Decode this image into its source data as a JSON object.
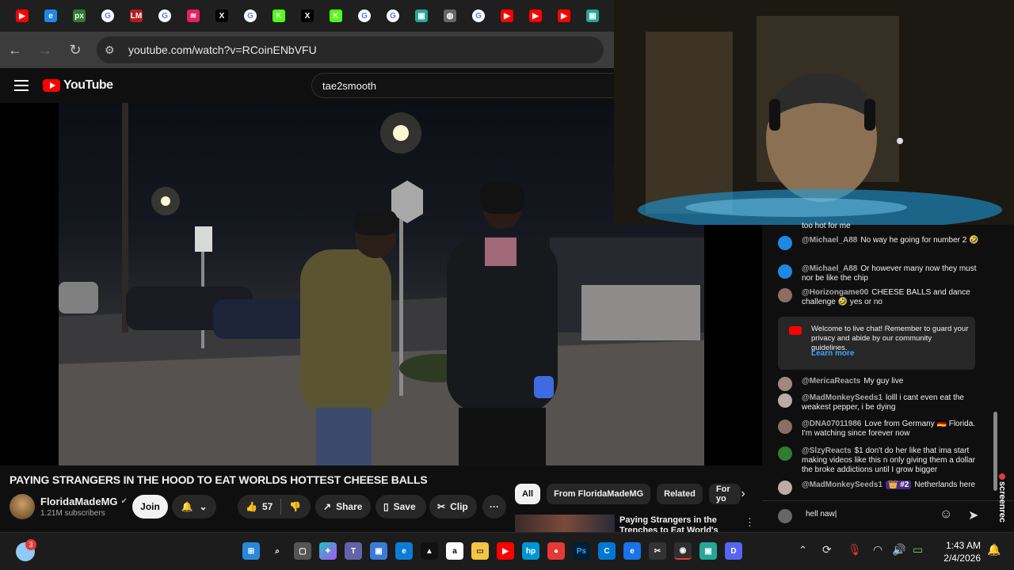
{
  "browser": {
    "tab_icons": [
      {
        "icon": "youtube-icon",
        "color": "#ff0000",
        "glyph": "▶"
      },
      {
        "icon": "edge-like-icon",
        "color": "#1e88e5",
        "glyph": "e"
      },
      {
        "icon": "px-icon",
        "color": "#2e7d32",
        "glyph": "px"
      },
      {
        "icon": "google-icon",
        "color": "#ffffff",
        "glyph": "G"
      },
      {
        "icon": "lm-icon",
        "color": "#b71c1c",
        "glyph": "LM"
      },
      {
        "icon": "google-icon",
        "color": "#ffffff",
        "glyph": "G"
      },
      {
        "icon": "podcast-icon",
        "color": "#e91e63",
        "glyph": "≋"
      },
      {
        "icon": "x-icon",
        "color": "#000000",
        "glyph": "X"
      },
      {
        "icon": "google-icon",
        "color": "#ffffff",
        "glyph": "G"
      },
      {
        "icon": "kick-icon",
        "color": "#53fc18",
        "glyph": "K"
      },
      {
        "icon": "x-icon",
        "color": "#000000",
        "glyph": "X"
      },
      {
        "icon": "kick-icon",
        "color": "#53fc18",
        "glyph": "K"
      },
      {
        "icon": "google-icon",
        "color": "#ffffff",
        "glyph": "G"
      },
      {
        "icon": "google-icon",
        "color": "#ffffff",
        "glyph": "G"
      },
      {
        "icon": "app-green-icon",
        "color": "#26a69a",
        "glyph": "▣"
      },
      {
        "icon": "globe-icon",
        "color": "#666666",
        "glyph": "◍"
      },
      {
        "icon": "google-icon",
        "color": "#ffffff",
        "glyph": "G"
      },
      {
        "icon": "youtube-icon",
        "color": "#ff0000",
        "glyph": "▶"
      },
      {
        "icon": "youtube-icon",
        "color": "#ff0000",
        "glyph": "▶"
      },
      {
        "icon": "youtube-icon",
        "color": "#ff0000",
        "glyph": "▶"
      },
      {
        "icon": "app-green-icon",
        "color": "#26a69a",
        "glyph": "▣"
      }
    ],
    "url": "youtube.com/watch?v=RCoinENbVFU"
  },
  "youtube": {
    "logo_text": "YouTube",
    "search_value": "tae2smooth",
    "video_title": "PAYING STRANGERS IN THE HOOD TO EAT WORLDS HOTTEST CHEESE BALLS",
    "channel_name": "FloridaMadeMG",
    "subscribers": "1.21M subscribers",
    "join_label": "Join",
    "likes": "57",
    "share_label": "Share",
    "save_label": "Save",
    "clip_label": "Clip",
    "more_label": "···"
  },
  "related": {
    "tabs": [
      "All",
      "From FloridaMadeMG",
      "Related",
      "For yo"
    ],
    "first_video_title": "Paying Strangers in the",
    "first_video_title_2": "Trenches to Eat World's Hottes"
  },
  "chat": {
    "messages": [
      {
        "author": "",
        "text": "too hot for me",
        "avatar_color": "#1e88e5"
      },
      {
        "author": "@Michael_A88",
        "text": "No way he going for number 2 🤣",
        "avatar_color": "#1e88e5"
      },
      {
        "author": "@Michael_A88",
        "text": "Or however many now they must nor be like the chip",
        "avatar_color": "#1e88e5"
      },
      {
        "author": "@Horizongame00",
        "text": "CHEESE BALLS and dance challenge 🤣 yes or no",
        "avatar_color": "#8d6e63"
      }
    ],
    "welcome_text": "Welcome to live chat! Remember to guard your privacy and abide by our community guidelines.",
    "learn_more": "Learn more",
    "messages_after": [
      {
        "author": "@MericaReacts",
        "text": "My guy live",
        "avatar_color": "#a1887f"
      },
      {
        "author": "@MadMonkeySeeds1",
        "text": "lolll i cant even eat the weakest pepper, i be dying",
        "avatar_color": "#bcaaa4"
      },
      {
        "author": "@DNA07011986",
        "text": "Love from Germany 🇩🇪 Florida. I'm watching since forever now",
        "avatar_color": "#8d6e63"
      },
      {
        "author": "@SlzyReacts",
        "text": "$1 don't do her like that ima start making videos like this n only giving them a dollar the broke addictions until I grow bigger",
        "avatar_color": "#2e7d32"
      },
      {
        "author": "@MadMonkeySeeds1",
        "text": "Netherlands here",
        "avatar_color": "#bcaaa4",
        "badge": "👑 #2"
      }
    ],
    "input_value": "hell naw|"
  },
  "overlay": {
    "screenrec_label": "screenrec"
  },
  "taskbar": {
    "weather_badge": "3",
    "time": "1:43 AM",
    "date": "2/4/2026"
  }
}
